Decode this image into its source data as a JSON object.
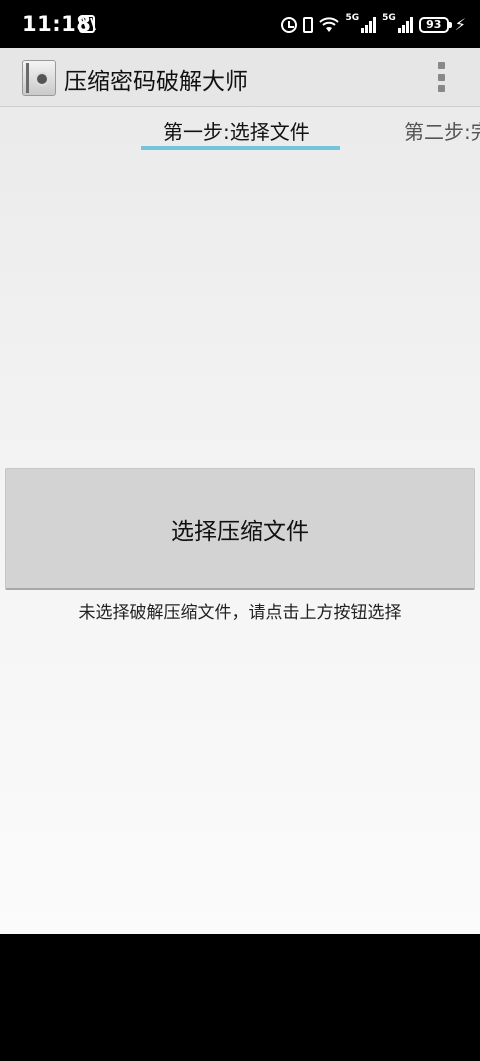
{
  "status_bar": {
    "time": "11:18",
    "net1": "5G",
    "net2": "5G",
    "battery": "93"
  },
  "action_bar": {
    "title": "压缩密码破解大师"
  },
  "tabs": [
    {
      "label": "第一步:选择文件",
      "selected": true
    },
    {
      "label": "第二步:完",
      "selected": false
    }
  ],
  "main": {
    "select_button_label": "选择压缩文件",
    "hint": "未选择破解压缩文件，请点击上方按钮选择"
  },
  "colors": {
    "tab_indicator": "#74c5db",
    "button_bg": "#d3d3d3",
    "action_bar_bg": "#e6e6e6"
  }
}
